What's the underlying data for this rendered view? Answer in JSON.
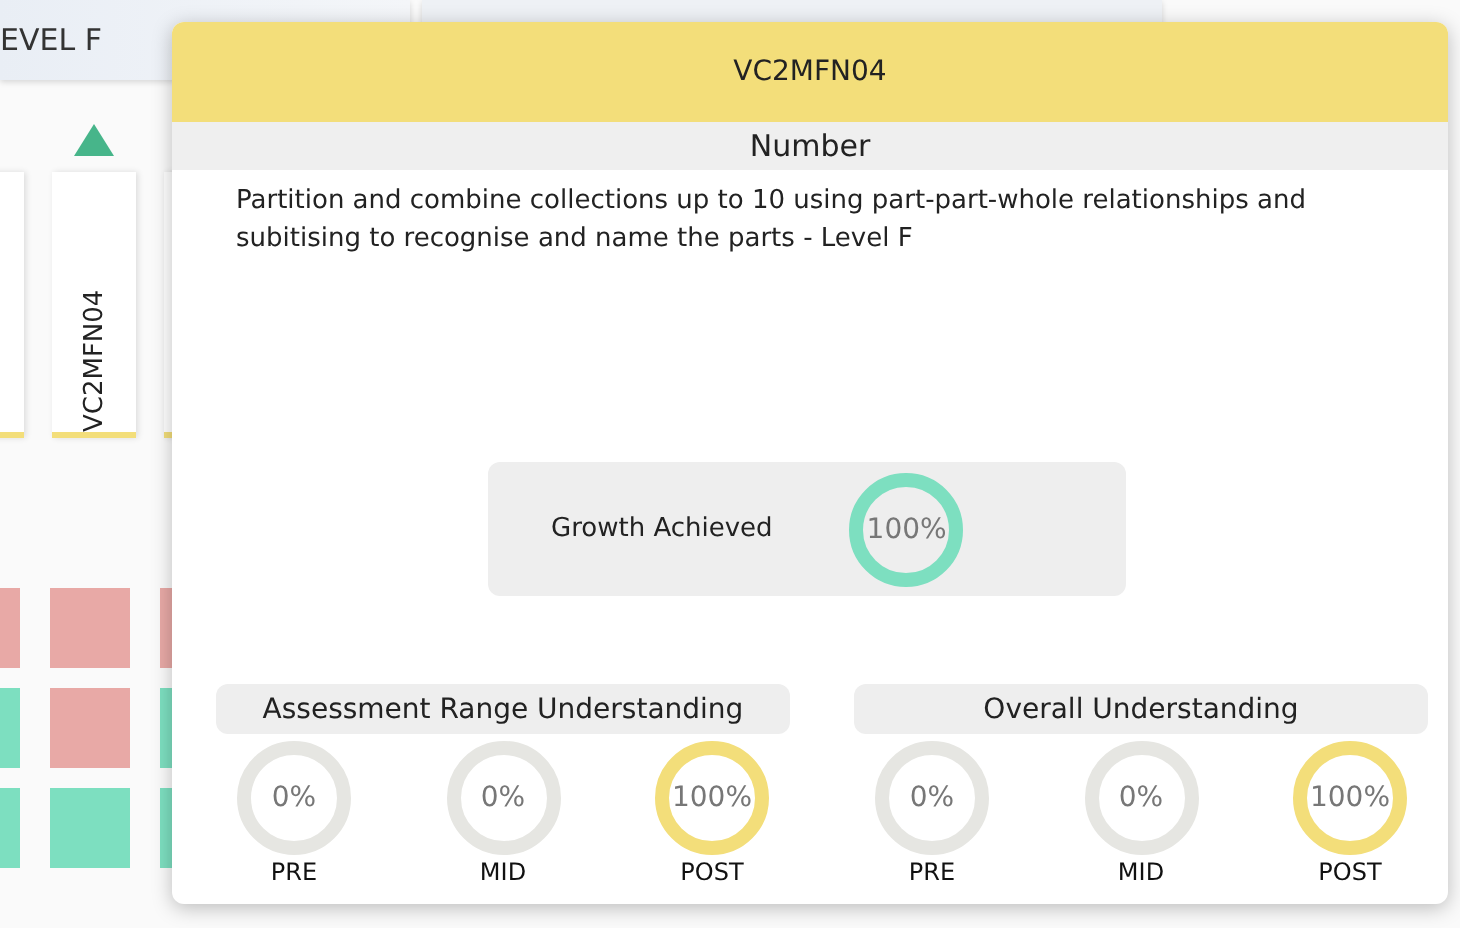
{
  "background": {
    "tab_label": "EVEL F",
    "column_header": "VC2MFN04",
    "grid_rows": [
      {
        "cells": [
          {
            "color": "#e8a9a6"
          },
          {
            "color": "#e8a9a6"
          },
          {
            "color": "#e8a9a6"
          }
        ]
      },
      {
        "cells": [
          {
            "color": "#7ddfc0"
          },
          {
            "color": "#e8a9a6"
          },
          {
            "color": "#7ddfc0"
          }
        ]
      },
      {
        "cells": [
          {
            "color": "#7ddfc0"
          },
          {
            "color": "#7ddfc0"
          },
          {
            "color": "#7ddfc0"
          }
        ]
      }
    ]
  },
  "modal": {
    "title": "VC2MFN04",
    "strand": "Number",
    "description": "Partition and combine collections up to 10 using part-part-whole relationships and subitising to recognise and name the parts - Level F",
    "growth": {
      "label": "Growth Achieved",
      "value": "100%",
      "complete": true
    },
    "groups": [
      {
        "title": "Assessment Range Understanding",
        "rings": [
          {
            "label": "PRE",
            "value": "0%",
            "complete": false
          },
          {
            "label": "MID",
            "value": "0%",
            "complete": false
          },
          {
            "label": "POST",
            "value": "100%",
            "complete": true
          }
        ]
      },
      {
        "title": "Overall Understanding",
        "rings": [
          {
            "label": "PRE",
            "value": "0%",
            "complete": false
          },
          {
            "label": "MID",
            "value": "0%",
            "complete": false
          },
          {
            "label": "POST",
            "value": "100%",
            "complete": true
          }
        ]
      }
    ]
  }
}
